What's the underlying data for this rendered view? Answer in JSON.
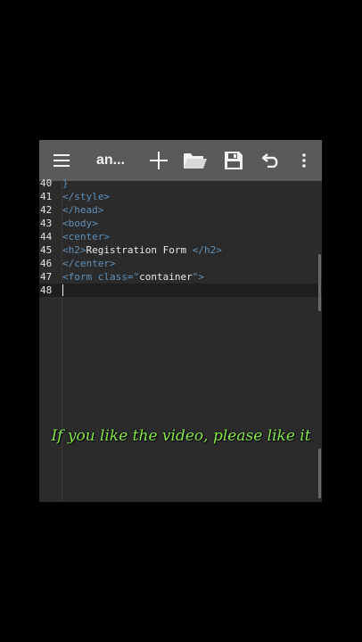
{
  "toolbar": {
    "title": "an...",
    "icons": [
      "menu-icon",
      "plus-icon",
      "folder-icon",
      "save-icon",
      "undo-icon",
      "more-vert-icon"
    ]
  },
  "editor": {
    "lines": [
      {
        "num": "40",
        "parts": [
          {
            "t": "}",
            "c": "tag"
          }
        ]
      },
      {
        "num": "41",
        "parts": [
          {
            "t": "</style>",
            "c": "tag"
          }
        ]
      },
      {
        "num": "42",
        "parts": [
          {
            "t": "</head>",
            "c": "tag"
          }
        ]
      },
      {
        "num": "43",
        "parts": [
          {
            "t": "<body>",
            "c": "tag"
          }
        ]
      },
      {
        "num": "44",
        "parts": [
          {
            "t": "<center>",
            "c": "tag"
          }
        ]
      },
      {
        "num": "45",
        "parts": [
          {
            "t": "<h2>",
            "c": "tag"
          },
          {
            "t": "Registration Form ",
            "c": "txt"
          },
          {
            "t": "</h2>",
            "c": "tag"
          }
        ]
      },
      {
        "num": "46",
        "parts": [
          {
            "t": "</center>",
            "c": "tag"
          }
        ]
      },
      {
        "num": "47",
        "parts": [
          {
            "t": "<form class=\"",
            "c": "tag"
          },
          {
            "t": "container",
            "c": "str"
          },
          {
            "t": "\">",
            "c": "tag"
          }
        ]
      },
      {
        "num": "48",
        "parts": []
      }
    ],
    "current_line": "48"
  },
  "caption": "If you like the video, please like it",
  "colors": {
    "background": "#000000",
    "toolbar": "#5a5a5a",
    "editor": "#2b2b2b",
    "tag": "#5f8fb8",
    "caption": "#86e84a"
  }
}
